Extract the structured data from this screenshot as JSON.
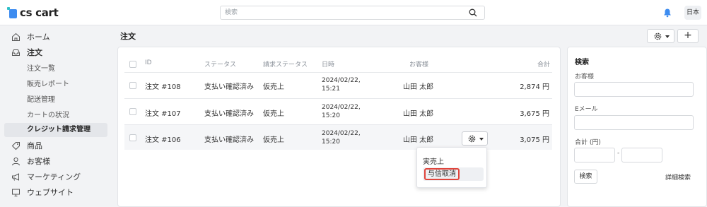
{
  "header": {
    "logo_text": "cs cart",
    "search_placeholder": "検索",
    "language": "日本"
  },
  "sidebar": {
    "items": [
      {
        "label": "ホーム",
        "icon": "home-icon"
      },
      {
        "label": "注文",
        "icon": "inbox-icon"
      },
      {
        "label": "注文一覧"
      },
      {
        "label": "販売レポート"
      },
      {
        "label": "配送管理"
      },
      {
        "label": "カートの状況"
      },
      {
        "label": "クレジット請求管理"
      },
      {
        "label": "商品",
        "icon": "tag-icon"
      },
      {
        "label": "お客様",
        "icon": "user-icon"
      },
      {
        "label": "マーケティング",
        "icon": "megaphone-icon"
      },
      {
        "label": "ウェブサイト",
        "icon": "monitor-icon"
      }
    ]
  },
  "main": {
    "title": "注文",
    "plus_label": "+",
    "table": {
      "headers": [
        "ID",
        "ステータス",
        "請求ステータス",
        "日時",
        "お客様",
        "合計"
      ],
      "rows": [
        {
          "id": "注文 #108",
          "status": "支払い確認済み",
          "billing": "仮売上",
          "date": "2024/02/22, 15:21",
          "customer": "山田 太郎",
          "total": "2,874 円"
        },
        {
          "id": "注文 #107",
          "status": "支払い確認済み",
          "billing": "仮売上",
          "date": "2024/02/22, 15:20",
          "customer": "山田 太郎",
          "total": "3,675 円"
        },
        {
          "id": "注文 #106",
          "status": "支払い確認済み",
          "billing": "仮売上",
          "date": "2024/02/22, 15:20",
          "customer": "山田 太郎",
          "total": "3,075 円"
        }
      ]
    },
    "dropdown": {
      "items": [
        "実売上",
        "与信取消"
      ]
    }
  },
  "search_panel": {
    "title": "検索",
    "customer_label": "お客様",
    "email_label": "Eメール",
    "total_label": "合計 (円)",
    "range_separator": "-",
    "search_button": "検索",
    "advanced_link": "詳細検索"
  },
  "colors": {
    "accent": "#3d8cf0",
    "logo_secondary": "#2ec0c8",
    "highlight_border": "#e0453c"
  }
}
